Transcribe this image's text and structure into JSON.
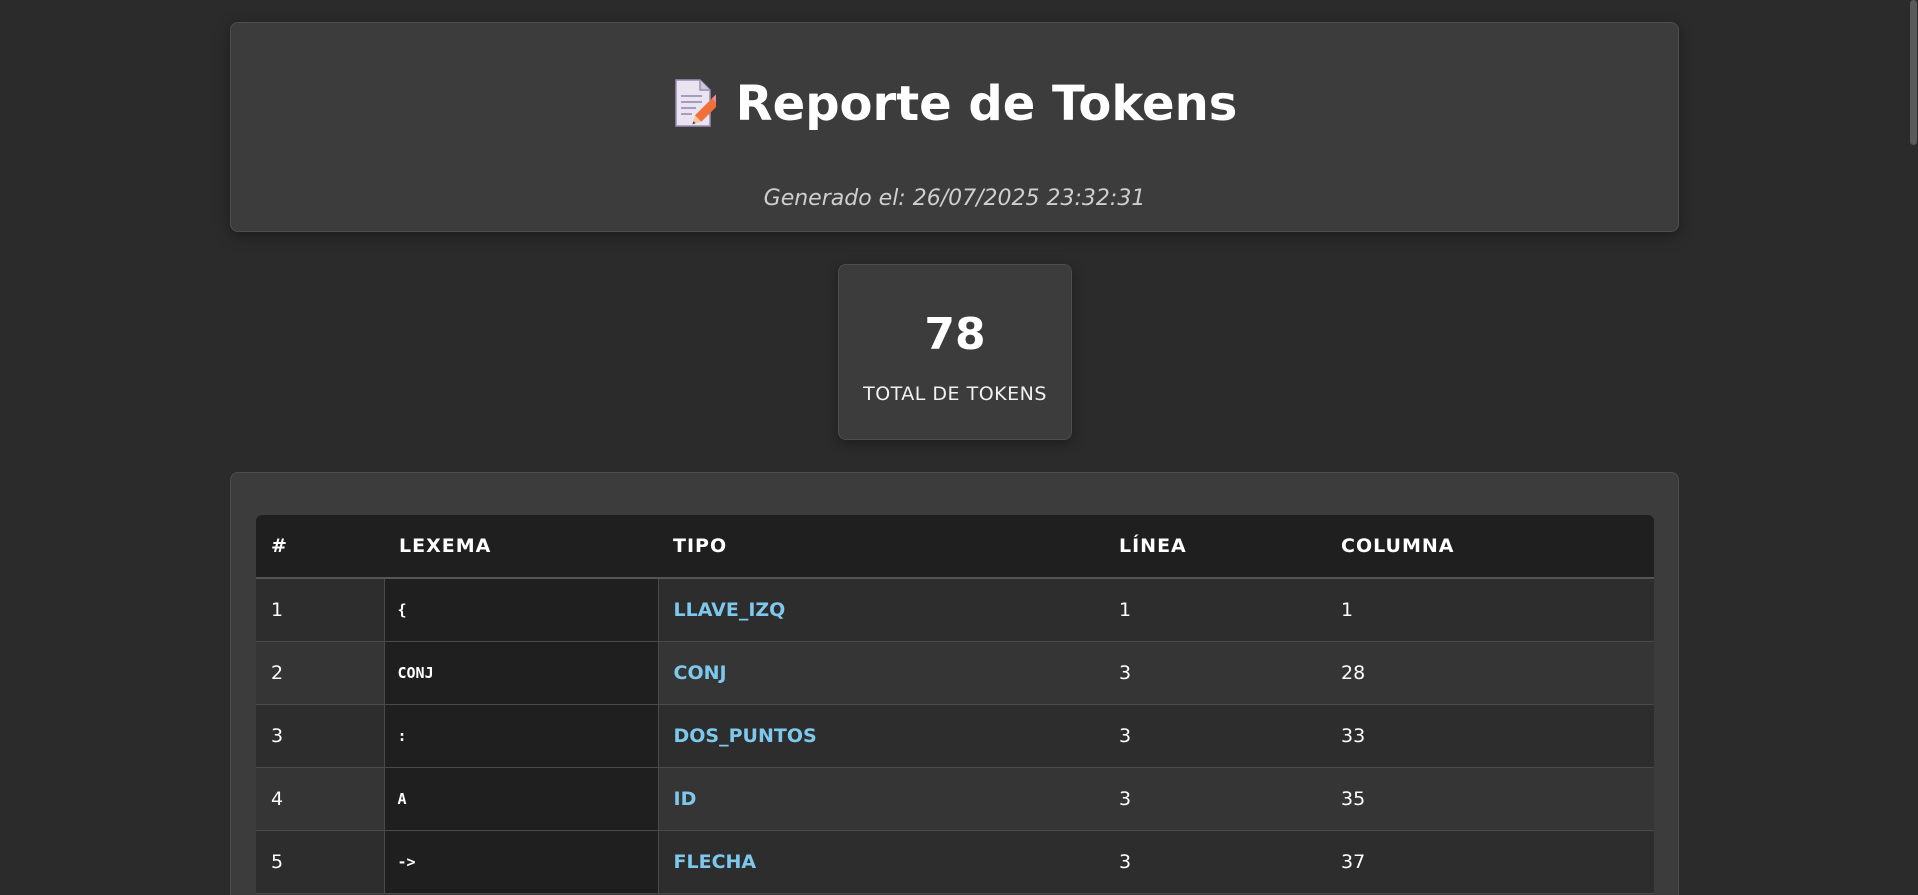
{
  "header": {
    "icon": "memo-pencil-icon",
    "title": "Reporte de Tokens",
    "subtitle": "Generado el: 26/07/2025 23:32:31"
  },
  "stats": {
    "total_value": "78",
    "total_label": "TOTAL DE TOKENS"
  },
  "table": {
    "columns": [
      "#",
      "LEXEMA",
      "TIPO",
      "LÍNEA",
      "COLUMNA"
    ],
    "rows": [
      {
        "num": "1",
        "lexema": "{",
        "tipo": "LLAVE_IZQ",
        "linea": "1",
        "columna": "1"
      },
      {
        "num": "2",
        "lexema": "CONJ",
        "tipo": "CONJ",
        "linea": "3",
        "columna": "28"
      },
      {
        "num": "3",
        "lexema": ":",
        "tipo": "DOS_PUNTOS",
        "linea": "3",
        "columna": "33"
      },
      {
        "num": "4",
        "lexema": "A",
        "tipo": "ID",
        "linea": "3",
        "columna": "35"
      },
      {
        "num": "5",
        "lexema": "->",
        "tipo": "FLECHA",
        "linea": "3",
        "columna": "37"
      }
    ]
  },
  "colors": {
    "background": "#2b2b2b",
    "card": "#3c3c3c",
    "accent_tipo": "#7ec8ee"
  }
}
